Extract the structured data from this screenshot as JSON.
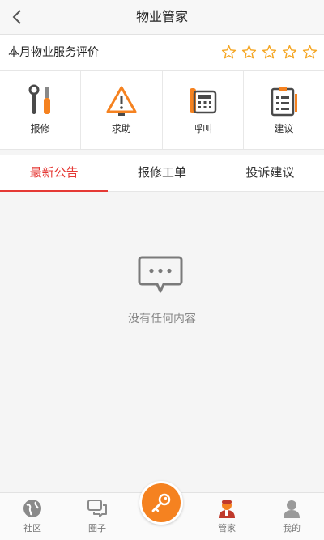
{
  "header": {
    "title": "物业管家"
  },
  "rating": {
    "label": "本月物业服务评价",
    "stars": 5,
    "filled": 0,
    "star_color": "#f5a623"
  },
  "actions": [
    {
      "label": "报修",
      "icon": "repair-tools-icon"
    },
    {
      "label": "求助",
      "icon": "warning-triangle-icon"
    },
    {
      "label": "呼叫",
      "icon": "telephone-icon"
    },
    {
      "label": "建议",
      "icon": "clipboard-icon"
    }
  ],
  "tabs": [
    {
      "label": "最新公告",
      "active": true
    },
    {
      "label": "报修工单",
      "active": false
    },
    {
      "label": "投诉建议",
      "active": false
    }
  ],
  "empty": {
    "text": "没有任何内容",
    "icon": "chat-bubble-icon"
  },
  "tabbar": [
    {
      "label": "社区",
      "icon": "community-globe-icon",
      "active": false
    },
    {
      "label": "圈子",
      "icon": "chat-bubbles-icon",
      "active": false
    },
    {
      "label": "",
      "icon": "key-icon",
      "active": false
    },
    {
      "label": "管家",
      "icon": "butler-icon",
      "active": true
    },
    {
      "label": "我的",
      "icon": "user-icon",
      "active": false
    }
  ],
  "colors": {
    "accent": "#e53935",
    "brand_orange": "#f58220",
    "active_tab_text": "#f07c00"
  }
}
